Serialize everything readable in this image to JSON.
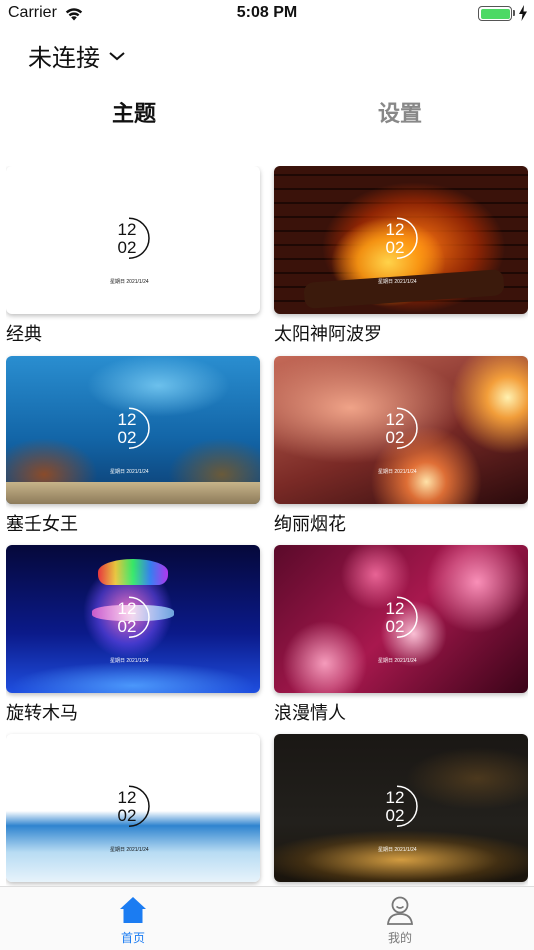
{
  "status": {
    "carrier": "Carrier",
    "time": "5:08 PM"
  },
  "header": {
    "connection": "未连接"
  },
  "tabs": {
    "theme": "主题",
    "settings": "设置"
  },
  "clock": {
    "hour": "12",
    "minute": "02",
    "date": "星期日   2021/1/24"
  },
  "themes": [
    {
      "label": "经典"
    },
    {
      "label": "太阳神阿波罗"
    },
    {
      "label": "塞壬女王"
    },
    {
      "label": "绚丽烟花"
    },
    {
      "label": "旋转木马"
    },
    {
      "label": "浪漫情人"
    },
    {
      "label": ""
    },
    {
      "label": ""
    }
  ],
  "tabbar": {
    "home": "首页",
    "mine": "我的"
  },
  "colors": {
    "accent": "#1b7cf2",
    "battery": "#4cd964"
  }
}
